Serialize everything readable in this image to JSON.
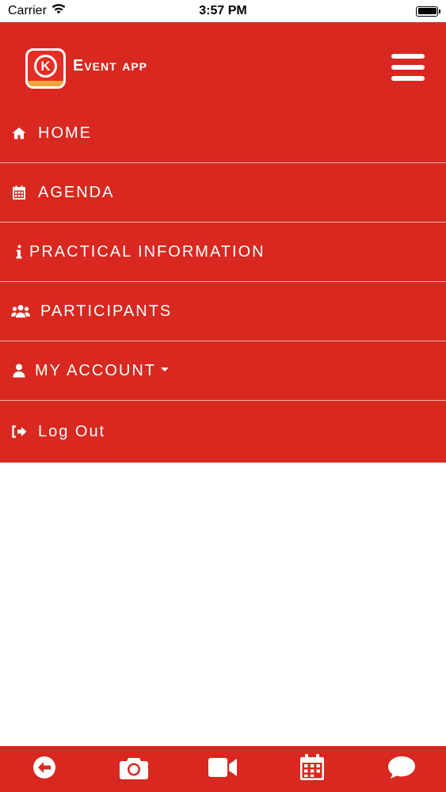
{
  "status_bar": {
    "carrier": "Carrier",
    "time": "3:57 PM"
  },
  "header": {
    "app_title": "Event app",
    "logo_letter": "K"
  },
  "menu": {
    "items": [
      {
        "label": "HOME",
        "icon": "home-icon"
      },
      {
        "label": "AGENDA",
        "icon": "calendar-icon"
      },
      {
        "label": "PRACTICAL INFORMATION",
        "icon": "info-icon"
      },
      {
        "label": "PARTICIPANTS",
        "icon": "users-icon"
      },
      {
        "label": "MY ACCOUNT",
        "icon": "user-icon"
      },
      {
        "label": "Log Out",
        "icon": "sign-out-icon"
      }
    ]
  },
  "bottom_bar": {
    "icons": [
      "back-arrow-icon",
      "camera-icon",
      "video-camera-icon",
      "calendar-icon",
      "chat-bubble-icon"
    ]
  },
  "colors": {
    "primary": "#d8281f",
    "divider": "#f0b4b0",
    "logo_stripe": "#f3a53b"
  }
}
